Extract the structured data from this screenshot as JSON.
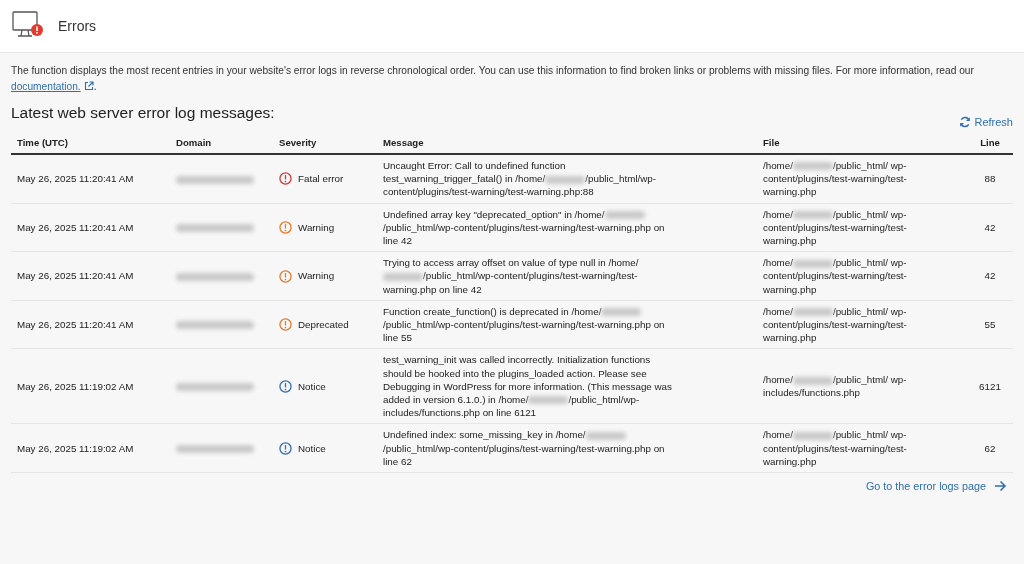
{
  "header": {
    "title": "Errors"
  },
  "intro": {
    "text": "The function displays the most recent entries in your website's error logs in reverse chronological order. You can use this information to find broken links or problems with missing files. For more information, read our ",
    "link": "documentation.",
    "tail": "."
  },
  "section": {
    "title": "Latest web server error log messages:",
    "refresh": "Refresh"
  },
  "table": {
    "columns": [
      "Time (UTC)",
      "Domain",
      "Severity",
      "Message",
      "File",
      "Line"
    ],
    "rows": [
      {
        "time": "May 26, 2025 11:20:41 AM",
        "severity": {
          "kind": "fatal",
          "label": "Fatal error"
        },
        "message": [
          "Uncaught Error: Call to undefined function test_warning_trigger_fatal() in /home/",
          "/public_html/wp-content/plugins/test-warning/test-warning.php:88"
        ],
        "file": [
          "/home/",
          "/public_html/ wp-content/plugins/test-warning/test-warning.php"
        ],
        "line": "88"
      },
      {
        "time": "May 26, 2025 11:20:41 AM",
        "severity": {
          "kind": "warning",
          "label": "Warning"
        },
        "message": [
          "Undefined array key \"deprecated_option\" in /home/",
          "/public_html/wp-content/plugins/test-warning/test-warning.php on line 42"
        ],
        "file": [
          "/home/",
          "/public_html/ wp-content/plugins/test-warning/test-warning.php"
        ],
        "line": "42"
      },
      {
        "time": "May 26, 2025 11:20:41 AM",
        "severity": {
          "kind": "warning",
          "label": "Warning"
        },
        "message": [
          "Trying to access array offset on value of type null in /home/",
          "/public_html/wp-content/plugins/test-warning/test-warning.php on line 42"
        ],
        "file": [
          "/home/",
          "/public_html/ wp-content/plugins/test-warning/test-warning.php"
        ],
        "line": "42"
      },
      {
        "time": "May 26, 2025 11:20:41 AM",
        "severity": {
          "kind": "deprecated",
          "label": "Deprecated"
        },
        "message": [
          "Function create_function() is deprecated in /home/",
          "/public_html/wp-content/plugins/test-warning/test-warning.php on line 55"
        ],
        "file": [
          "/home/",
          "/public_html/ wp-content/plugins/test-warning/test-warning.php"
        ],
        "line": "55"
      },
      {
        "time": "May 26, 2025 11:19:02 AM",
        "severity": {
          "kind": "notice",
          "label": "Notice"
        },
        "message": [
          "test_warning_init was called incorrectly. Initialization functions should be hooked into the plugins_loaded action. Please see Debugging in WordPress for more information. (This message was added in version 6.1.0.) in /home/",
          "/public_html/wp-includes/functions.php on line 6121"
        ],
        "file": [
          "/home/",
          "/public_html/ wp-includes/functions.php"
        ],
        "line": "6121"
      },
      {
        "time": "May 26, 2025 11:19:02 AM",
        "severity": {
          "kind": "notice",
          "label": "Notice"
        },
        "message": [
          "Undefined index: some_missing_key in /home/",
          "/public_html/wp-content/plugins/test-warning/test-warning.php on line 62"
        ],
        "file": [
          "/home/",
          "/public_html/ wp-content/plugins/test-warning/test-warning.php"
        ],
        "line": "62"
      }
    ]
  },
  "footer_link": "Go to the error logs page"
}
